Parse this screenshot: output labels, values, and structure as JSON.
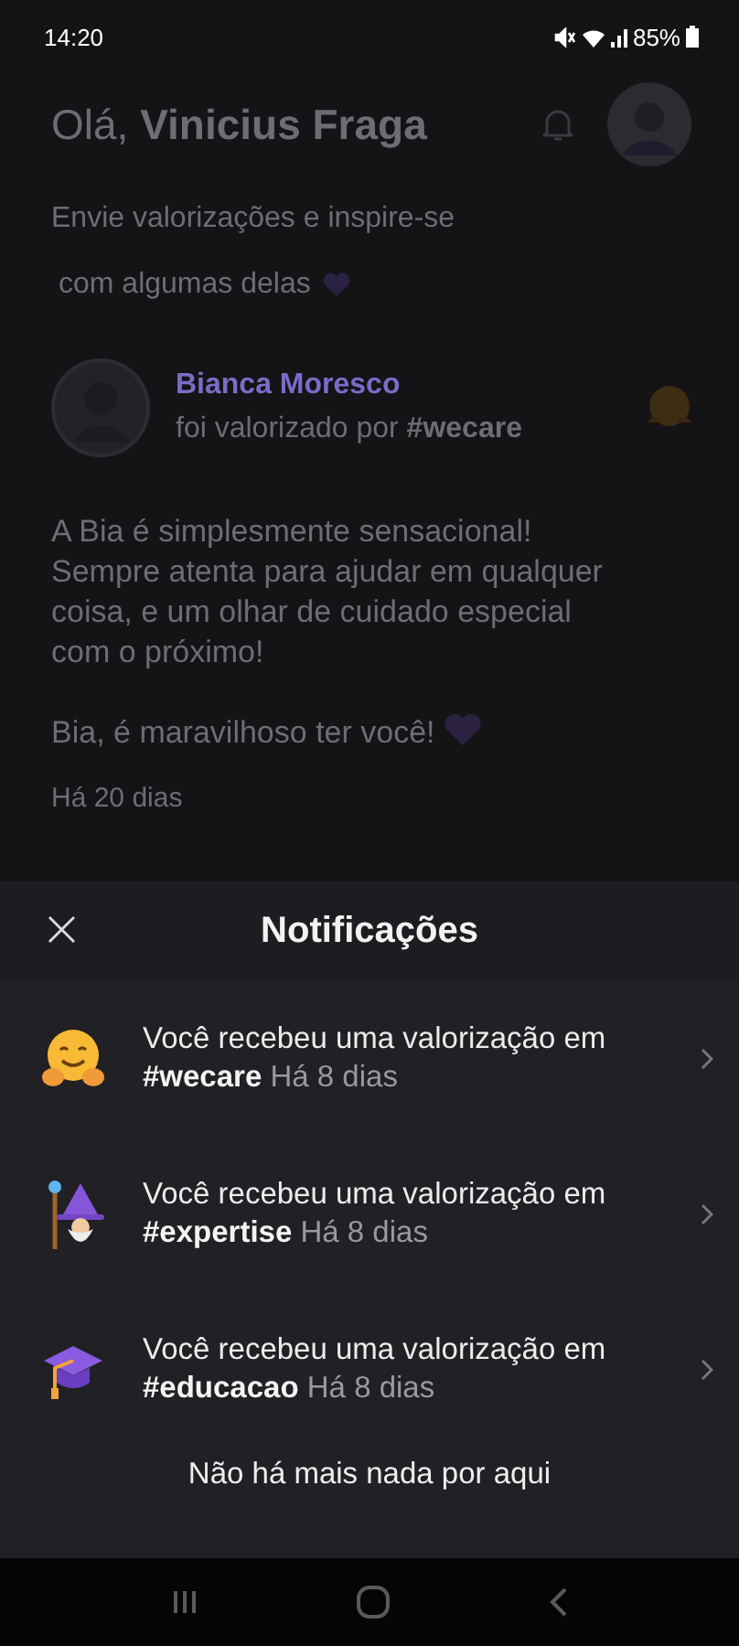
{
  "status_bar": {
    "time": "14:20",
    "battery": "85%"
  },
  "header": {
    "greeting": "Olá, **Vinicius Fraga**",
    "subtitle_lines": [
      "Envie valorizações e inspire-se",
      "com algumas delas"
    ]
  },
  "post": {
    "author": "Bianca Moresco",
    "caption": "foi valorizado por **#wecare**",
    "paragraphs": [
      "A Bia é simplesmente sensacional! Sempre atenta para ajudar em qualquer coisa, e um olhar de cuidado especial com o próximo!",
      "Bia, é maravilhoso ter você!"
    ],
    "time": "Há 20 dias"
  },
  "sheet": {
    "title": "Notificações",
    "close": "×",
    "items": [
      {
        "kind": "hug",
        "message": "Você recebeu uma valorização em",
        "tag": "#wecare",
        "time": "Há 8 dias"
      },
      {
        "kind": "wizard",
        "message": "Você recebeu uma valorização em",
        "tag": "#expertise",
        "time": "Há 8 dias"
      },
      {
        "kind": "cap",
        "message": "Você recebeu uma valorização em",
        "tag": "#educacao",
        "time": "Há 8 dias"
      }
    ],
    "footer": "Não há mais nada por aqui"
  }
}
